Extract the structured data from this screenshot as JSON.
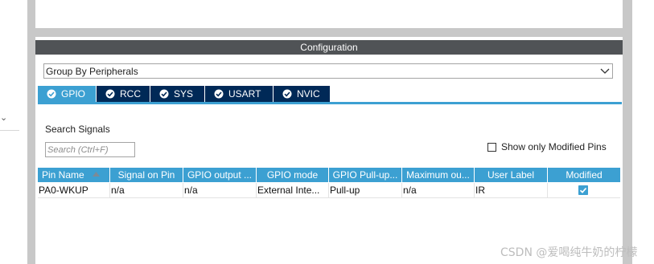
{
  "config_title": "Configuration",
  "group_by": {
    "selected": "Group By Peripherals"
  },
  "tabs": [
    {
      "label": "GPIO",
      "active": true
    },
    {
      "label": "RCC",
      "active": false
    },
    {
      "label": "SYS",
      "active": false
    },
    {
      "label": "USART",
      "active": false
    },
    {
      "label": "NVIC",
      "active": false
    }
  ],
  "search": {
    "label": "Search Signals",
    "placeholder": "Search (Ctrl+F)"
  },
  "modified_filter": {
    "label": "Show only Modified Pins",
    "checked": false
  },
  "table": {
    "columns": [
      "Pin Name",
      "Signal on Pin",
      "GPIO output ...",
      "GPIO mode",
      "GPIO Pull-up...",
      "Maximum ou...",
      "User Label",
      "Modified"
    ],
    "rows": [
      {
        "pin_name": "PA0-WKUP",
        "signal_on_pin": "n/a",
        "gpio_output": "n/a",
        "gpio_mode": "External Inte...",
        "gpio_pull": "Pull-up",
        "maximum_output": "n/a",
        "user_label": "IR",
        "modified": true
      }
    ]
  },
  "watermark": "CSDN @爱喝纯牛奶的柠檬",
  "colors": {
    "accent": "#3ca0d2",
    "tab_dark": "#002957",
    "header_gray": "#505356",
    "frame_gray": "#c8c8c8"
  },
  "icons": {
    "tab_status": "check-circle-icon",
    "dropdown": "chevron-down-icon",
    "sort": "sort-ascending-icon",
    "modified": "checkbox-checked-icon"
  }
}
